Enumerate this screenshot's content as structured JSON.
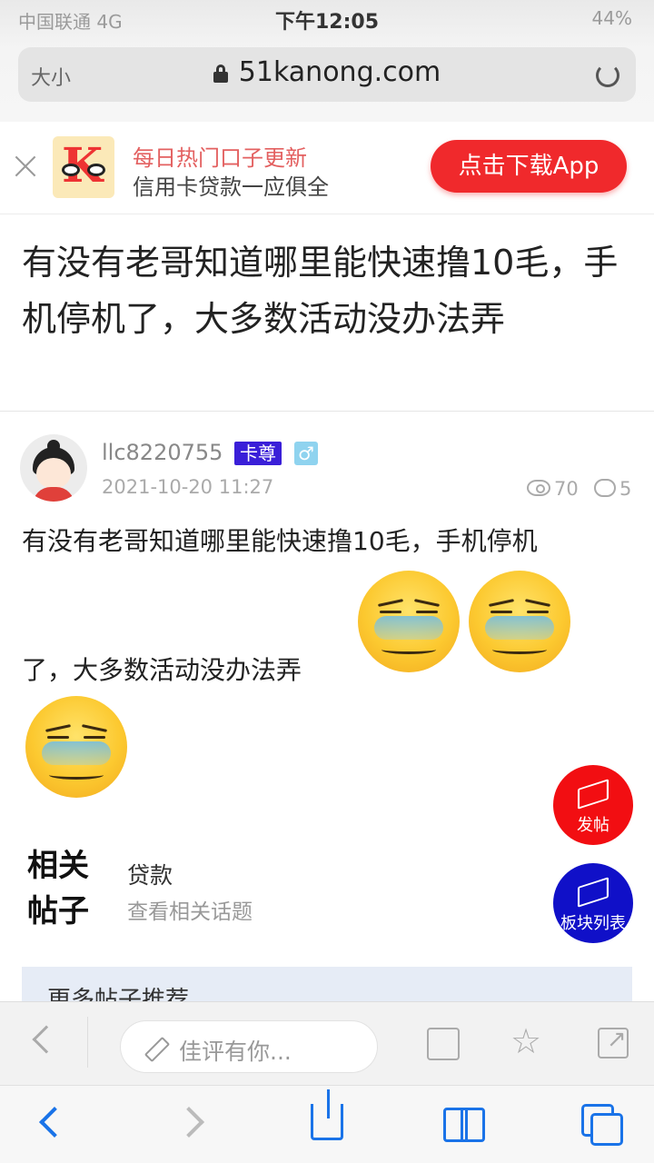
{
  "status_bar": {
    "carrier": "中国联通 4G",
    "time": "下午12:05",
    "battery": "44%"
  },
  "browser": {
    "text_size": "大小",
    "url": "51kanong.com"
  },
  "app_banner": {
    "title": "每日热门口子更新",
    "subtitle": "信用卡贷款一应俱全",
    "download_label": "点击下载App",
    "logo_letter": "K"
  },
  "post": {
    "title": "有没有老哥知道哪里能快速撸10毛，手机停机了，大多数活动没办法弄",
    "author": "llc8220755",
    "rank_badge": "卡尊",
    "gender": "♂",
    "date": "2021-10-20 11:27",
    "views": "70",
    "comments": "5",
    "body_line1": "有没有老哥知道哪里能快速撸10毛，手机停机",
    "body_line2": "了，大多数活动没办法弄"
  },
  "fabs": {
    "post_label": "发帖",
    "board_label": "板块列表"
  },
  "related": {
    "heading": "相关帖子",
    "tag": "贷款",
    "link": "查看相关话题"
  },
  "more_posts": {
    "label": "更多帖子推荐"
  },
  "site_toolbar": {
    "comment_placeholder": "佳评有你..."
  },
  "colors": {
    "brand_red": "#f0292c",
    "fab_red": "#f20e12",
    "fab_blue": "#1010c8",
    "safari_blue": "#1a73e8",
    "rank_badge": "#3a1fd8"
  }
}
